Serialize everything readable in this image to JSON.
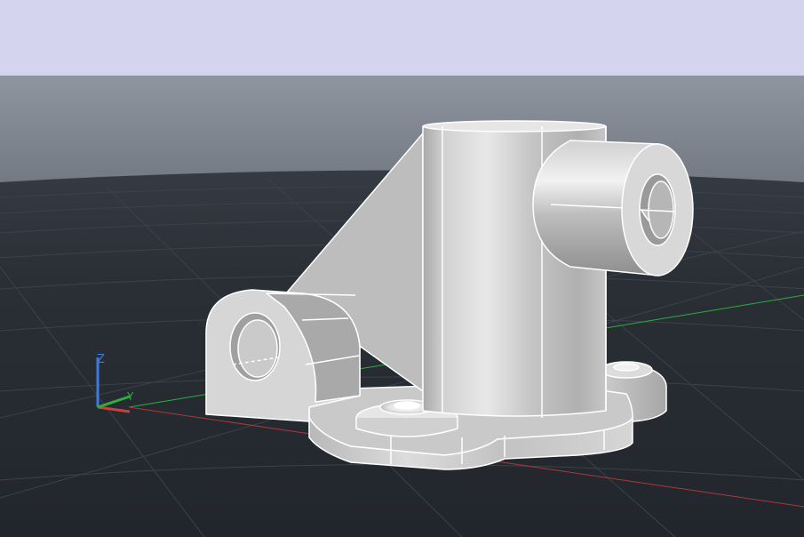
{
  "colors": {
    "top_band": "#d4d4ee",
    "sky_top": "#8e959e",
    "sky_bottom": "#424952",
    "ground": "#262a31",
    "grid": "#3b424b",
    "x_axis": "#c8413e",
    "y_axis": "#2fae3a",
    "z_axis": "#3d7be0",
    "edge": "#ffffff"
  },
  "ucs": {
    "z_label": "Z",
    "y_label": "Y"
  },
  "model": {
    "name_icon": "3d-solid-part"
  }
}
